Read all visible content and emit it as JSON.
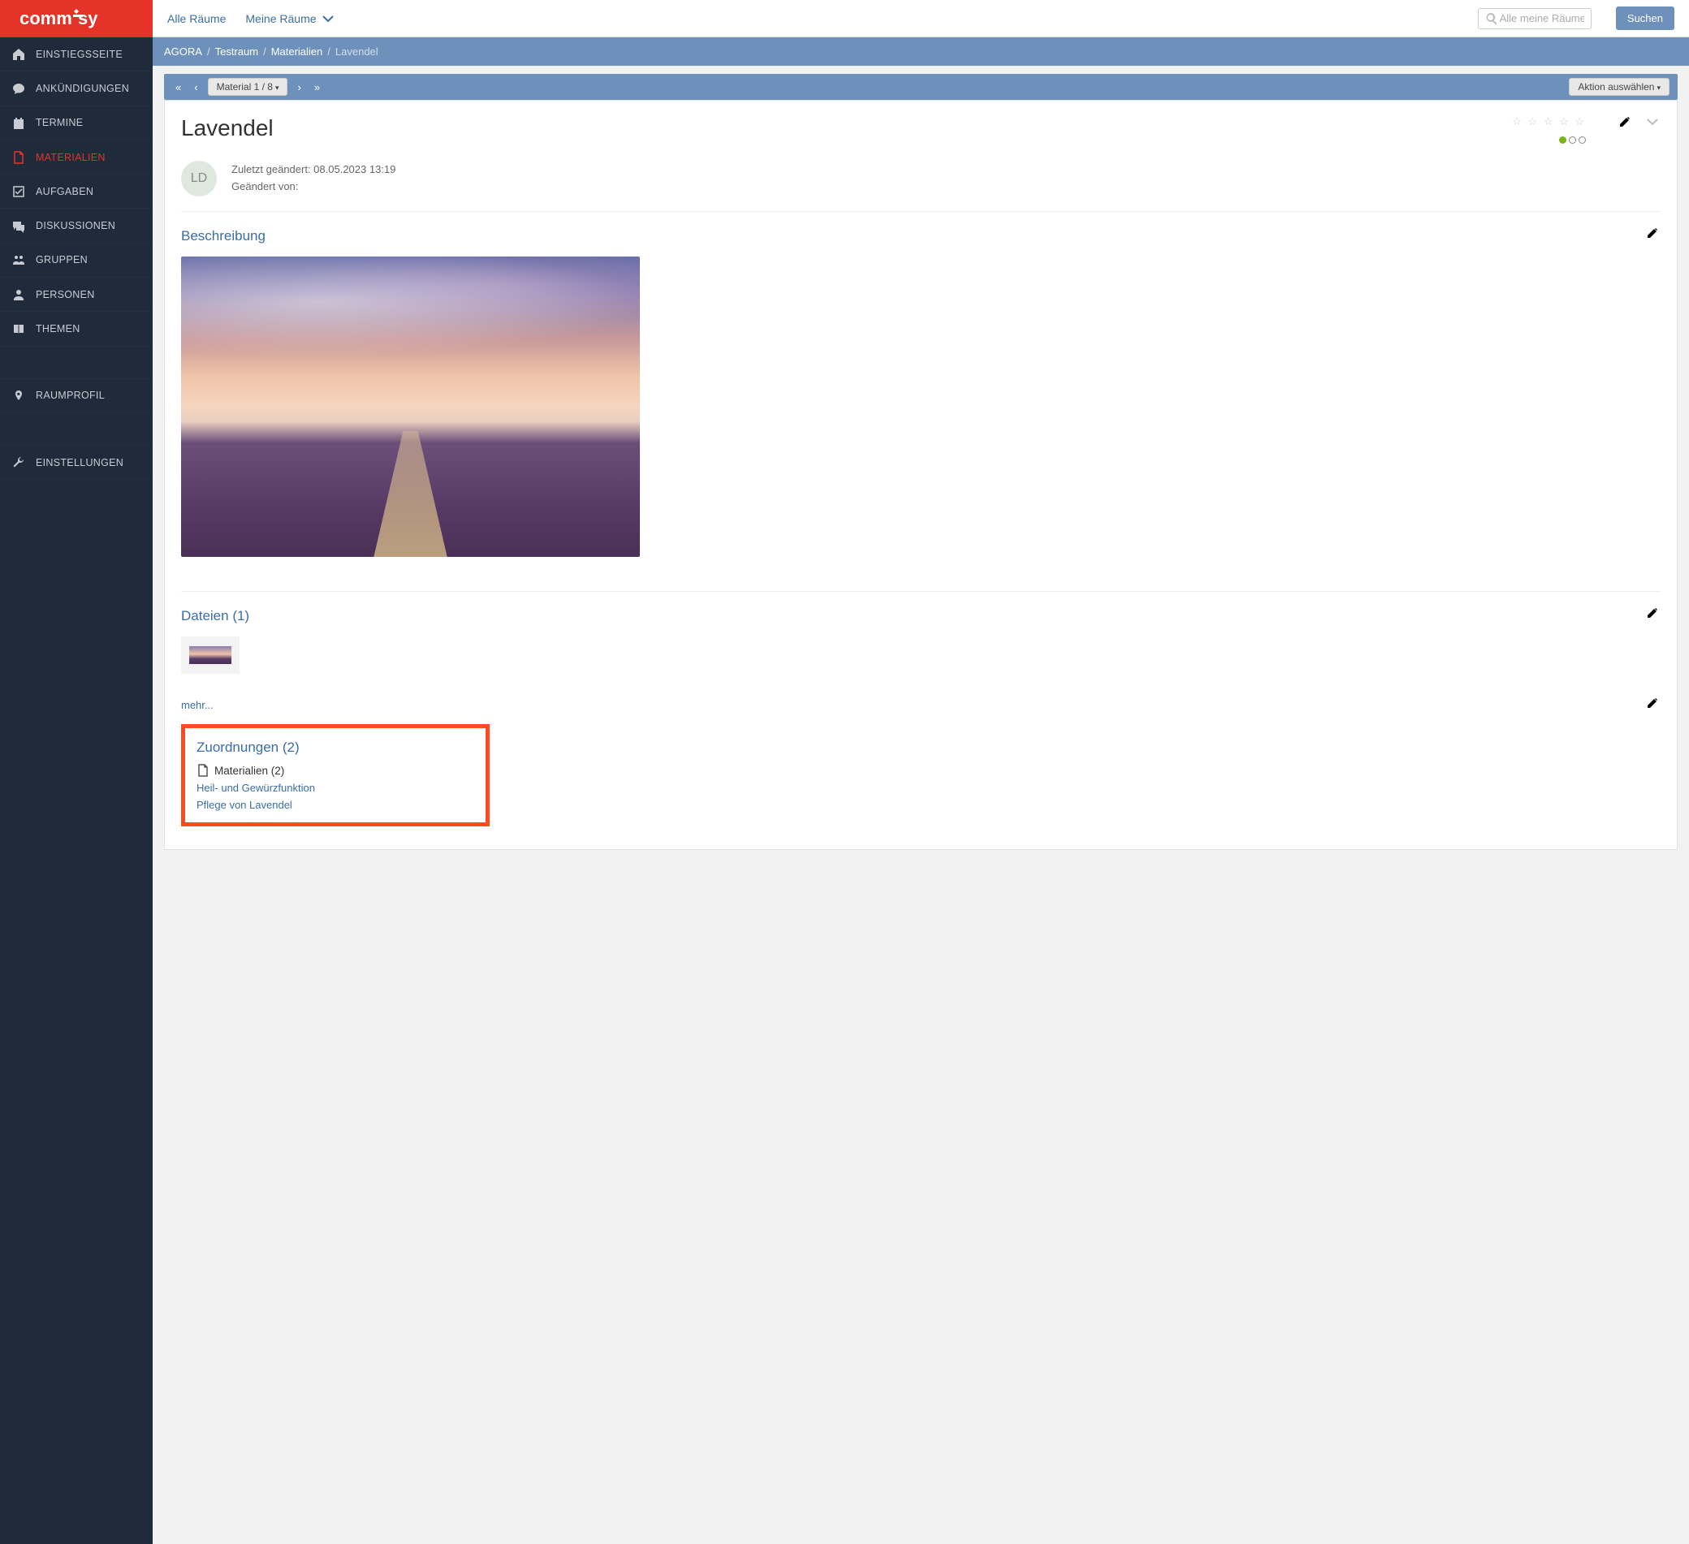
{
  "logo": "commsy",
  "topbar": {
    "allRooms": "Alle Räume",
    "myRooms": "Meine Räume",
    "searchPlaceholder": "Alle meine Räume...",
    "searchButton": "Suchen"
  },
  "breadcrumb": {
    "items": [
      "AGORA",
      "Testraum",
      "Materialien"
    ],
    "current": "Lavendel"
  },
  "sidebar": {
    "items": [
      {
        "label": "EINSTIEGSSEITE",
        "icon": "home"
      },
      {
        "label": "ANKÜNDIGUNGEN",
        "icon": "bubble"
      },
      {
        "label": "TERMINE",
        "icon": "calendar"
      },
      {
        "label": "MATERIALIEN",
        "icon": "file",
        "active": true
      },
      {
        "label": "AUFGABEN",
        "icon": "check"
      },
      {
        "label": "DISKUSSIONEN",
        "icon": "chat"
      },
      {
        "label": "GRUPPEN",
        "icon": "group"
      },
      {
        "label": "PERSONEN",
        "icon": "user"
      },
      {
        "label": "THEMEN",
        "icon": "book"
      }
    ],
    "secondary": [
      {
        "label": "RAUMPROFIL",
        "icon": "pin"
      }
    ],
    "tertiary": [
      {
        "label": "EINSTELLUNGEN",
        "icon": "wrench"
      }
    ]
  },
  "navstrip": {
    "materialBadge": "Material 1 / 8",
    "actionDropdown": "Aktion auswählen"
  },
  "page": {
    "title": "Lavendel",
    "avatar": "LD",
    "lastChangedLabel": "Zuletzt geändert: 08.05.2023 13:19",
    "changedByLabel": "Geändert von:",
    "descriptionTitle": "Beschreibung",
    "filesTitle": "Dateien (1)",
    "moreLabel": "mehr...",
    "assignmentsTitle": "Zuordnungen (2)",
    "assignmentsSub": "Materialien (2)",
    "assignmentLinks": [
      "Heil- und Gewürzfunktion",
      "Pflege von Lavendel"
    ]
  }
}
